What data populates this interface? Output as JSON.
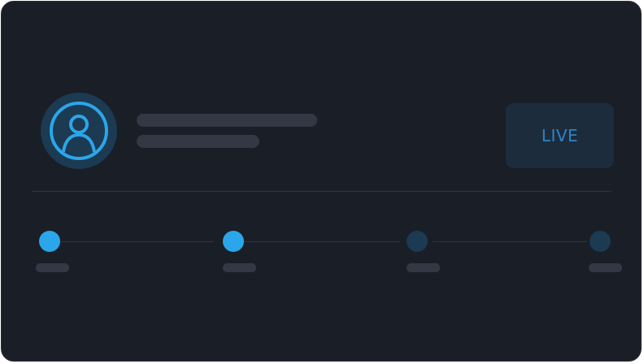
{
  "status_button": {
    "label": "LIVE"
  },
  "profile": {
    "avatar_icon": "user-icon"
  },
  "stepper": {
    "total_steps": 4,
    "completed_steps": 2
  },
  "colors": {
    "background": "#1a1e27",
    "accent": "#2ba6ea",
    "accent_dim": "#1c3a52",
    "live_text": "#2f84c2",
    "live_bg": "#1c2c3d",
    "skeleton": "#343844"
  }
}
